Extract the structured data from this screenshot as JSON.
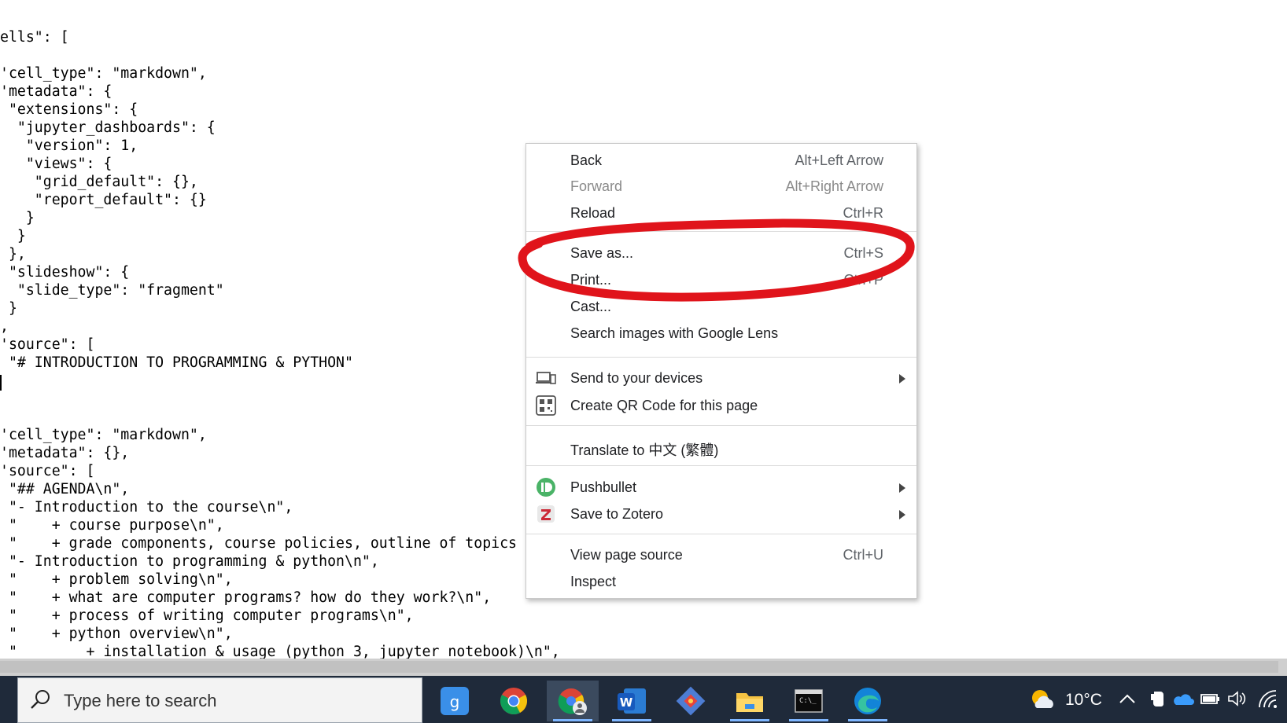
{
  "page": {
    "code_lines": [
      "ells\": [",
      "",
      "'cell_type\": \"markdown\",",
      "'metadata\": {",
      " \"extensions\": {",
      "  \"jupyter_dashboards\": {",
      "   \"version\": 1,",
      "   \"views\": {",
      "    \"grid_default\": {},",
      "    \"report_default\": {}",
      "   }",
      "  }",
      " },",
      " \"slideshow\": {",
      "  \"slide_type\": \"fragment\"",
      " }",
      ",",
      "'source\": [",
      " \"# INTRODUCTION TO PROGRAMMING & PYTHON\"",
      "",
      "",
      "",
      "'cell_type\": \"markdown\",",
      "'metadata\": {},",
      "'source\": [",
      " \"## AGENDA\\n\",",
      " \"- Introduction to the course\\n\",",
      " \"    + course purpose\\n\",",
      " \"    + grade components, course policies, outline of topics cc",
      " \"- Introduction to programming & python\\n\",",
      " \"    + problem solving\\n\",",
      " \"    + what are computer programs? how do they work?\\n\",",
      " \"    + process of writing computer programs\\n\",",
      " \"    + python overview\\n\",",
      " \"        + installation & usage (python 3, jupyter notebook)\\n\","
    ]
  },
  "context_menu": {
    "items": [
      {
        "label": "Back",
        "shortcut": "Alt+Left Arrow"
      },
      {
        "label": "Forward",
        "shortcut": "Alt+Right Arrow"
      },
      {
        "label": "Reload",
        "shortcut": "Ctrl+R"
      },
      {
        "label": "Save as...",
        "shortcut": "Ctrl+S"
      },
      {
        "label": "Print...",
        "shortcut": "Ctrl+P"
      },
      {
        "label": "Cast...",
        "shortcut": ""
      },
      {
        "label": "Search images with Google Lens",
        "shortcut": ""
      },
      {
        "label": "Send to your devices",
        "shortcut": ""
      },
      {
        "label": "Create QR Code for this page",
        "shortcut": ""
      },
      {
        "label": "Translate to 中文 (繁體)",
        "shortcut": ""
      },
      {
        "label": "Pushbullet",
        "shortcut": ""
      },
      {
        "label": "Save to Zotero",
        "shortcut": ""
      },
      {
        "label": "View page source",
        "shortcut": "Ctrl+U"
      },
      {
        "label": "Inspect",
        "shortcut": ""
      }
    ],
    "highlight_color": "#e0141b"
  },
  "taskbar": {
    "search_placeholder": "Type here to search",
    "temperature": "10°C",
    "icons": [
      "word-icon",
      "chrome-icon",
      "chrome-profile-icon",
      "word-icon",
      "git-icon",
      "file-explorer-icon",
      "terminal-icon",
      "edge-icon"
    ]
  }
}
